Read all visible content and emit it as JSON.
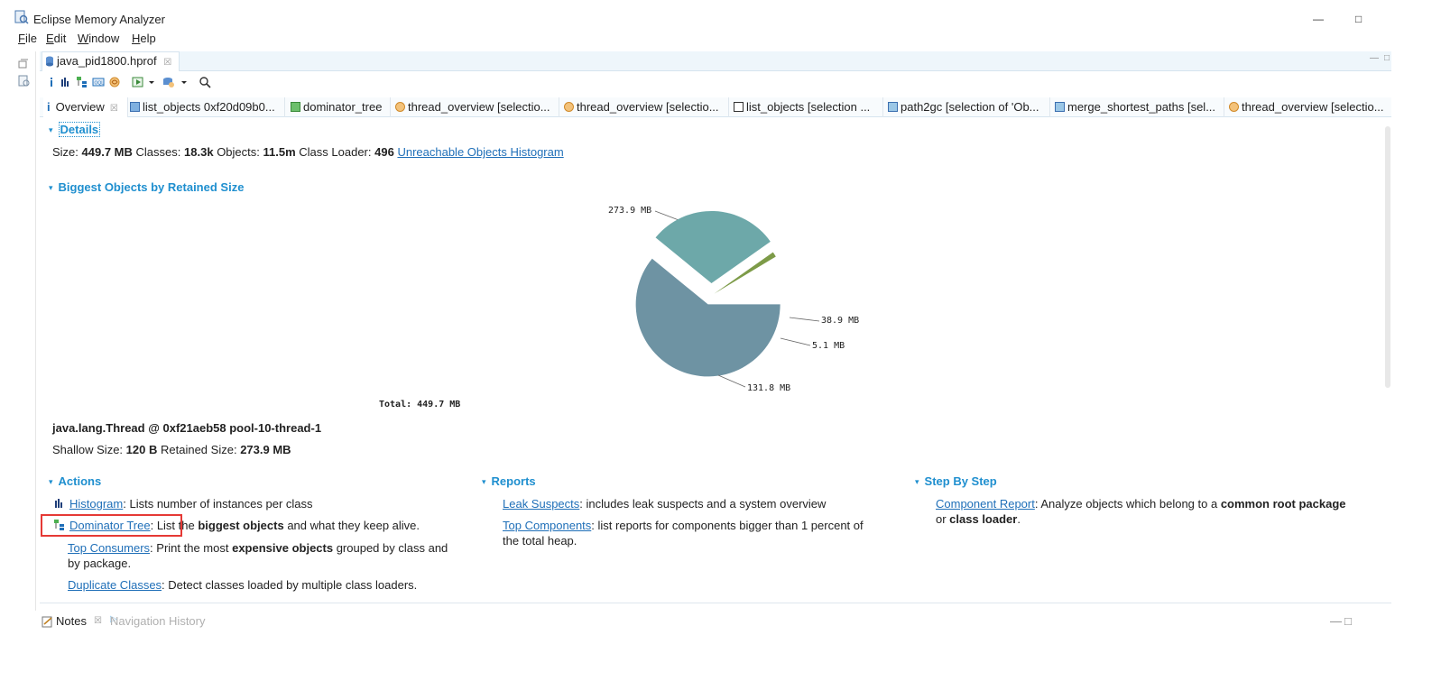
{
  "window": {
    "title": "Eclipse Memory Analyzer",
    "minimize_glyph": "—",
    "restore_glyph": "□"
  },
  "menu": [
    "File",
    "Edit",
    "Window",
    "Help"
  ],
  "editor": {
    "file_tab": "java_pid1800.hprof",
    "close_glyph": "☒"
  },
  "toolbar": {
    "icons": [
      "info-icon",
      "histogram-icon",
      "dominator-tree-icon",
      "oql-icon",
      "thread-icon",
      "query-browser-icon",
      "dropdown-icon",
      "heap-dump-icon",
      "dropdown-icon",
      "search-icon"
    ]
  },
  "tabs": [
    {
      "label": "Overview",
      "icon": "info-icon"
    },
    {
      "label": "list_objects 0xf20d09b0...",
      "icon": "list-objects-icon"
    },
    {
      "label": "dominator_tree",
      "icon": "dominator-tree-icon"
    },
    {
      "label": "thread_overview [selectio...",
      "icon": "thread-icon"
    },
    {
      "label": "thread_overview [selectio...",
      "icon": "thread-icon"
    },
    {
      "label": "list_objects [selection ...",
      "icon": "list-objects-icon"
    },
    {
      "label": "path2gc [selection of 'Ob...",
      "icon": "path-icon"
    },
    {
      "label": "merge_shortest_paths [sel...",
      "icon": "merge-icon"
    },
    {
      "label": "thread_overview [selectio...",
      "icon": "thread-icon"
    }
  ],
  "details": {
    "title": "Details",
    "size_label": "Size:",
    "size_value": "449.7 MB",
    "classes_label": "Classes:",
    "classes_value": "18.3k",
    "objects_label": "Objects:",
    "objects_value": "11.5m",
    "loader_label": "Class Loader:",
    "loader_value": "496",
    "unreachable_link": "Unreachable Objects Histogram"
  },
  "biggest": {
    "title": "Biggest Objects by Retained Size",
    "total_label": "Total: 449.7 MB",
    "slices": [
      {
        "label": "273.9 MB",
        "value": 273.9,
        "color": "#6e93a3"
      },
      {
        "label": "131.8 MB",
        "value": 131.8,
        "color": "#6da8a9"
      },
      {
        "label": "5.1 MB",
        "value": 5.1,
        "color": "#7d9b48"
      },
      {
        "label": "38.9 MB",
        "value": 38.9,
        "color": "#ffffff"
      }
    ],
    "selected_object": "java.lang.Thread @ 0xf21aeb58 pool-10-thread-1",
    "shallow_label": "Shallow Size:",
    "shallow_value": "120 B",
    "retained_label": "Retained Size:",
    "retained_value": "273.9 MB"
  },
  "actions": {
    "title": "Actions",
    "histogram_link": "Histogram",
    "histogram_desc": ": Lists number of instances per class",
    "dominator_link": "Dominator Tree",
    "dominator_desc_1": ": List the ",
    "dominator_desc_bold": "biggest objects",
    "dominator_desc_2": " and what they keep alive.",
    "top_consumers_link": "Top Consumers",
    "top_consumers_desc_1": ": Print the most ",
    "top_consumers_bold": "expensive objects",
    "top_consumers_desc_2": " grouped by class and",
    "top_consumers_desc_3": "by package.",
    "duplicate_link": "Duplicate Classes",
    "duplicate_desc": ": Detect classes loaded by multiple class loaders."
  },
  "reports": {
    "title": "Reports",
    "leak_link": "Leak Suspects",
    "leak_desc": ": includes leak suspects and a system overview",
    "top_components_link": "Top Components",
    "top_components_desc_1": ": list reports for components bigger than 1 percent of",
    "top_components_desc_2": "the total heap."
  },
  "step": {
    "title": "Step By Step",
    "component_link": "Component Report",
    "component_desc_1": ": Analyze objects which belong to a ",
    "component_bold_1": "common root package",
    "component_desc_2": "or ",
    "component_bold_2": "class loader",
    "component_desc_3": "."
  },
  "bottom": {
    "notes": "Notes",
    "nav_history": "Navigation History"
  },
  "colors": {
    "accent": "#1f8fcf",
    "link": "#1f6fb8",
    "highlight": "#e53935"
  }
}
